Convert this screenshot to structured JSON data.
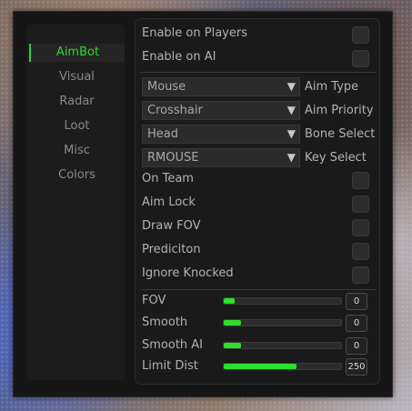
{
  "sidebar": {
    "items": [
      {
        "label": "AimBot",
        "active": true
      },
      {
        "label": "Visual",
        "active": false
      },
      {
        "label": "Radar",
        "active": false
      },
      {
        "label": "Loot",
        "active": false
      },
      {
        "label": "Misc",
        "active": false
      },
      {
        "label": "Colors",
        "active": false
      }
    ]
  },
  "toggles_top": [
    {
      "label": "Enable on Players"
    },
    {
      "label": "Enable on AI"
    }
  ],
  "selects": [
    {
      "value": "Mouse",
      "label": "Aim Type"
    },
    {
      "value": "Crosshair",
      "label": "Aim Priority"
    },
    {
      "value": "Head",
      "label": "Bone Select"
    },
    {
      "value": "RMOUSE",
      "label": "Key Select"
    }
  ],
  "toggles": [
    {
      "label": "On Team"
    },
    {
      "label": "Aim Lock"
    },
    {
      "label": "Draw FOV"
    },
    {
      "label": "Prediciton"
    },
    {
      "label": "Ignore Knocked"
    }
  ],
  "sliders": [
    {
      "label": "FOV",
      "value": "0",
      "fill_fraction": 0.09
    },
    {
      "label": "Smooth",
      "value": "0",
      "fill_fraction": 0.15
    },
    {
      "label": "Smooth AI",
      "value": "0",
      "fill_fraction": 0.15
    },
    {
      "label": "Limit Dist",
      "value": "250",
      "fill_fraction": 0.62
    }
  ],
  "colors": {
    "accent": "#31d631",
    "slider_fill": "#2ce02c",
    "window_bg": "#161616"
  },
  "icons": {
    "dropdown": "triangle-down-icon"
  },
  "glyphs": {
    "dropdown_arrow": "▼"
  }
}
